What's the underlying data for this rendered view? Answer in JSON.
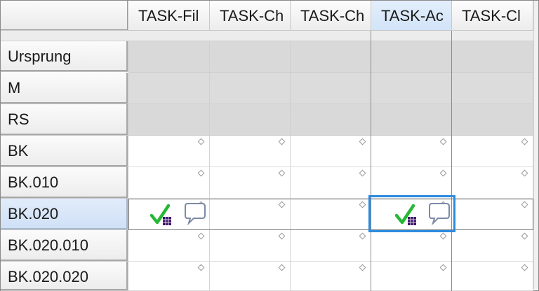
{
  "grid": {
    "columns": [
      {
        "label": "TASK-Fil"
      },
      {
        "label": "TASK-Ch"
      },
      {
        "label": "TASK-Ch"
      },
      {
        "label": "TASK-Ac"
      },
      {
        "label": "TASK-Cl"
      }
    ],
    "rows": [
      {
        "label": "Ursprung"
      },
      {
        "label": "M"
      },
      {
        "label": "RS"
      },
      {
        "label": "BK"
      },
      {
        "label": "BK.010"
      },
      {
        "label": "BK.020"
      },
      {
        "label": "BK.020.010"
      },
      {
        "label": "BK.020.020"
      }
    ],
    "selected_row": "BK.020",
    "selected_column": "TASK-Ac",
    "cell_icons": [
      "check-with-grid-icon",
      "speech-bubble-icon"
    ],
    "colors": {
      "selection_border": "#2b8be0",
      "header_selected_bg": "#d2e4f8",
      "check_green": "#2bbb3a",
      "readonly_gray": "#d9d9d9"
    }
  }
}
